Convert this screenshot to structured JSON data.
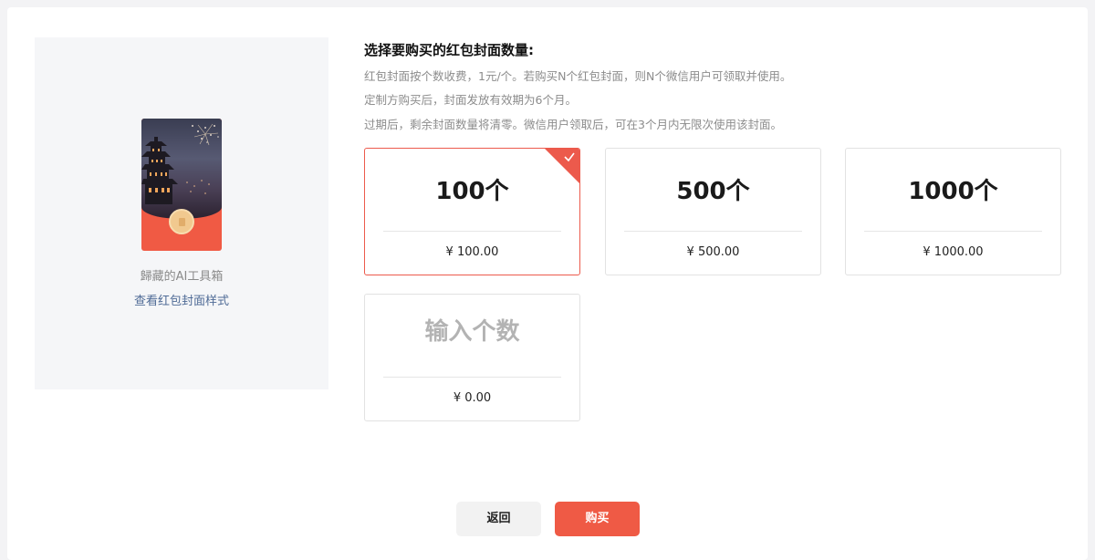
{
  "preview": {
    "brand_name": "歸藏的AI工具箱",
    "view_style_link": "查看红包封面样式"
  },
  "purchase": {
    "title": "选择要购买的红包封面数量:",
    "desc_line1": "红包封面按个数收费，1元/个。若购买N个红包封面，则N个微信用户可领取并使用。",
    "desc_line2": "定制方购买后，封面发放有效期为6个月。",
    "desc_line3": "过期后，剩余封面数量将清零。微信用户领取后，可在3个月内无限次使用该封面。",
    "options": [
      {
        "qty": "100个",
        "price": "¥ 100.00",
        "selected": true
      },
      {
        "qty": "500个",
        "price": "¥ 500.00",
        "selected": false
      },
      {
        "qty": "1000个",
        "price": "¥ 1000.00",
        "selected": false
      }
    ],
    "custom": {
      "placeholder": "输入个数",
      "price": "¥ 0.00"
    }
  },
  "buttons": {
    "back": "返回",
    "buy": "购买"
  },
  "colors": {
    "accent": "#ef5a45",
    "link": "#4f6b96"
  }
}
